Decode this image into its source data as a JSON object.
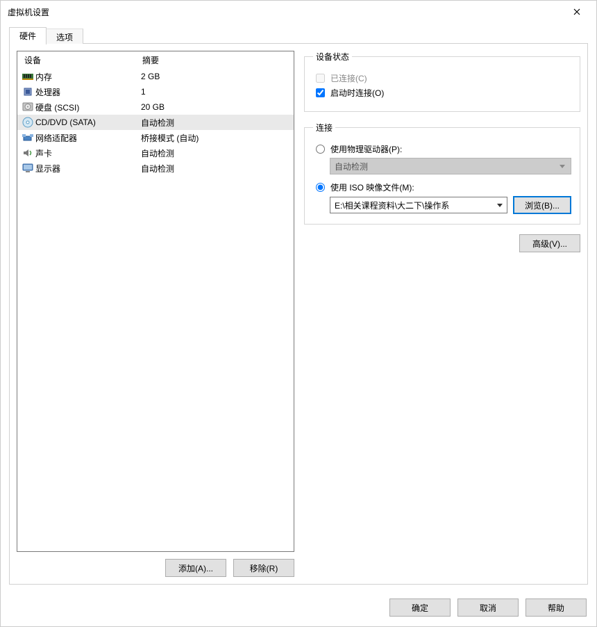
{
  "window": {
    "title": "虚拟机设置"
  },
  "tabs": {
    "hardware": "硬件",
    "options": "选项"
  },
  "deviceList": {
    "header": {
      "device": "设备",
      "summary": "摘要"
    },
    "rows": [
      {
        "icon": "memory-icon",
        "name": "内存",
        "summary": "2 GB"
      },
      {
        "icon": "cpu-icon",
        "name": "处理器",
        "summary": "1"
      },
      {
        "icon": "disk-icon",
        "name": "硬盘 (SCSI)",
        "summary": "20 GB"
      },
      {
        "icon": "cd-icon",
        "name": "CD/DVD (SATA)",
        "summary": "自动检测",
        "selected": true
      },
      {
        "icon": "network-icon",
        "name": "网络适配器",
        "summary": "桥接模式 (自动)"
      },
      {
        "icon": "sound-icon",
        "name": "声卡",
        "summary": "自动检测"
      },
      {
        "icon": "display-icon",
        "name": "显示器",
        "summary": "自动检测"
      }
    ]
  },
  "leftButtons": {
    "add": "添加(A)...",
    "remove": "移除(R)"
  },
  "deviceStatus": {
    "legend": "设备状态",
    "connected": "已连接(C)",
    "connectOnPowerOn": "启动时连接(O)"
  },
  "connection": {
    "legend": "连接",
    "usePhysical": "使用物理驱动器(P):",
    "physicalValue": "自动检测",
    "useIso": "使用 ISO 映像文件(M):",
    "isoPath": "E:\\相关课程资料\\大二下\\操作系",
    "browse": "浏览(B)..."
  },
  "advanced": "高级(V)...",
  "footer": {
    "ok": "确定",
    "cancel": "取消",
    "help": "帮助"
  }
}
